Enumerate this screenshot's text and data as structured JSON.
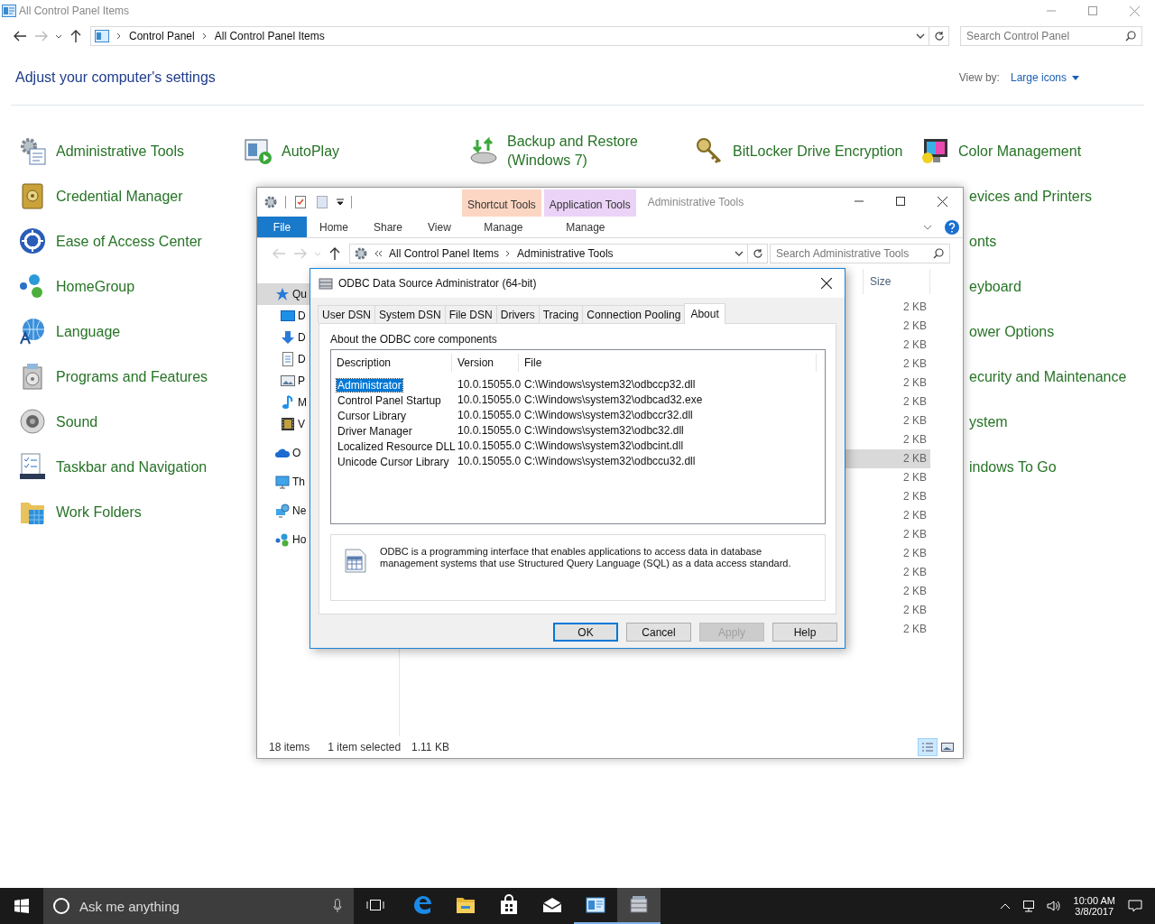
{
  "control_panel": {
    "title": "All Control Panel Items",
    "breadcrumb": [
      "Control Panel",
      "All Control Panel Items"
    ],
    "search": {
      "placeholder": "Search Control Panel"
    },
    "heading": "Adjust your computer's settings",
    "view_by": {
      "label": "View by:",
      "value": "Large icons"
    },
    "columns": [
      {
        "items": [
          {
            "label": "Administrative Tools"
          },
          {
            "label": "Credential Manager"
          },
          {
            "label": "Ease of Access Center"
          },
          {
            "label": "HomeGroup"
          },
          {
            "label": "Language"
          },
          {
            "label": "Programs and Features"
          },
          {
            "label": "Sound"
          },
          {
            "label": "Taskbar and Navigation"
          },
          {
            "label": "Work Folders"
          }
        ]
      },
      {
        "items": [
          {
            "label": "AutoPlay"
          }
        ]
      },
      {
        "items": [
          {
            "label": "Backup and Restore (Windows 7)"
          }
        ]
      },
      {
        "items": [
          {
            "label": "BitLocker Drive Encryption"
          }
        ]
      },
      {
        "items": [
          {
            "label": "Color Management"
          },
          {
            "label": "evices and Printers"
          },
          {
            "label": "onts"
          },
          {
            "label": "eyboard"
          },
          {
            "label": "ower Options"
          },
          {
            "label": "ecurity and Maintenance"
          },
          {
            "label": "ystem"
          },
          {
            "label": "indows To Go"
          }
        ]
      }
    ]
  },
  "explorer": {
    "title": "Administrative Tools",
    "file_tab": "File",
    "tabs": [
      "Home",
      "Share",
      "View"
    ],
    "contextual_tabs": [
      {
        "header": "Shortcut Tools",
        "tab": "Manage",
        "color": "#fcd6c2"
      },
      {
        "header": "Application Tools",
        "tab": "Manage",
        "color": "#ead3f7"
      }
    ],
    "breadcrumb": [
      "All Control Panel Items",
      "Administrative Tools"
    ],
    "search": {
      "placeholder": "Search Administrative Tools"
    },
    "nav": [
      {
        "label": "Qu",
        "selected": true,
        "children": [
          {
            "label": "D",
            "selected": false
          },
          {
            "label": "D",
            "selected": false
          },
          {
            "label": "D",
            "selected": false
          },
          {
            "label": "P",
            "selected": false
          },
          {
            "label": "M",
            "selected": false
          },
          {
            "label": "V",
            "selected": false
          }
        ]
      },
      {
        "label": "O",
        "selected": false
      },
      {
        "label": "Th",
        "selected": false
      },
      {
        "label": "Ne",
        "selected": false
      },
      {
        "label": "Ho",
        "selected": false
      }
    ],
    "size_header": "Size",
    "sizes": [
      {
        "size": "2 KB",
        "selected": false
      },
      {
        "size": "2 KB",
        "selected": false
      },
      {
        "size": "2 KB",
        "selected": false
      },
      {
        "size": "2 KB",
        "selected": false
      },
      {
        "size": "2 KB",
        "selected": false
      },
      {
        "size": "2 KB",
        "selected": false
      },
      {
        "size": "2 KB",
        "selected": false
      },
      {
        "size": "2 KB",
        "selected": false
      },
      {
        "size": "2 KB",
        "selected": true
      },
      {
        "size": "2 KB",
        "selected": false
      },
      {
        "size": "2 KB",
        "selected": false
      },
      {
        "size": "2 KB",
        "selected": false
      },
      {
        "size": "2 KB",
        "selected": false
      },
      {
        "size": "2 KB",
        "selected": false
      },
      {
        "size": "2 KB",
        "selected": false
      },
      {
        "size": "2 KB",
        "selected": false
      },
      {
        "size": "2 KB",
        "selected": false
      },
      {
        "size": "2 KB",
        "selected": false
      }
    ],
    "status": {
      "count": "18 items",
      "selection": "1 item selected",
      "selection_size": "1.11 KB"
    },
    "views": [
      {
        "selected": true
      },
      {
        "selected": false
      }
    ]
  },
  "dialog": {
    "title": "ODBC Data Source Administrator (64-bit)",
    "tabs": [
      {
        "label": "User DSN",
        "selected": false
      },
      {
        "label": "System DSN",
        "selected": false
      },
      {
        "label": "File DSN",
        "selected": false
      },
      {
        "label": "Drivers",
        "selected": false
      },
      {
        "label": "Tracing",
        "selected": false
      },
      {
        "label": "Connection Pooling",
        "selected": false
      },
      {
        "label": "About",
        "selected": true
      }
    ],
    "section_label": "About the ODBC core components",
    "columns": [
      "Description",
      "Version",
      "File"
    ],
    "rows": [
      {
        "description": "Administrator",
        "version": "10.0.15055.0",
        "file": "C:\\Windows\\system32\\odbccp32.dll",
        "selected": true
      },
      {
        "description": "Control Panel Startup",
        "version": "10.0.15055.0",
        "file": "C:\\Windows\\system32\\odbcad32.exe",
        "selected": false
      },
      {
        "description": "Cursor Library",
        "version": "10.0.15055.0",
        "file": "C:\\Windows\\system32\\odbccr32.dll",
        "selected": false
      },
      {
        "description": "Driver Manager",
        "version": "10.0.15055.0",
        "file": "C:\\Windows\\system32\\odbc32.dll",
        "selected": false
      },
      {
        "description": "Localized Resource DLL",
        "version": "10.0.15055.0",
        "file": "C:\\Windows\\system32\\odbcint.dll",
        "selected": false
      },
      {
        "description": "Unicode Cursor Library",
        "version": "10.0.15055.0",
        "file": "C:\\Windows\\system32\\odbccu32.dll",
        "selected": false
      }
    ],
    "info": "ODBC is a programming interface that enables applications to access data in database management systems that use Structured Query Language (SQL) as a data access standard.",
    "buttons": [
      {
        "label": "OK",
        "default": true,
        "disabled": false
      },
      {
        "label": "Cancel",
        "default": false,
        "disabled": false
      },
      {
        "label": "Apply",
        "default": false,
        "disabled": true
      },
      {
        "label": "Help",
        "default": false,
        "disabled": false
      }
    ]
  },
  "taskbar": {
    "search": {
      "placeholder": "Ask me anything"
    },
    "apps": [
      {
        "running": false,
        "focused": false
      },
      {
        "running": false,
        "focused": false
      },
      {
        "running": false,
        "focused": false
      },
      {
        "running": false,
        "focused": false
      },
      {
        "running": true,
        "focused": false
      },
      {
        "running": true,
        "focused": true
      }
    ],
    "time": "10:00 AM",
    "date": "3/8/2017"
  }
}
